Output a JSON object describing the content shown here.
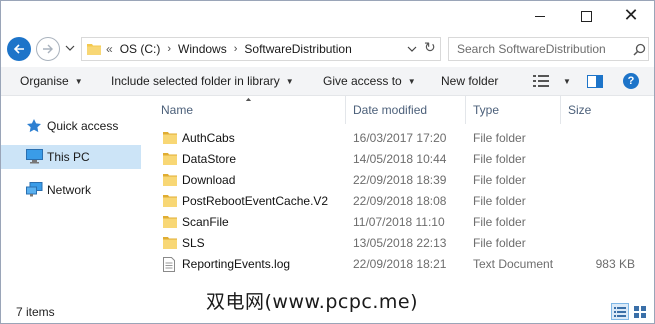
{
  "window": {
    "controls": {
      "minimize": "minimize-icon",
      "maximize": "maximize-icon",
      "close": "close-icon"
    }
  },
  "address_bar": {
    "lead": "«",
    "crumbs": [
      "OS (C:)",
      "Windows",
      "SoftwareDistribution"
    ]
  },
  "search": {
    "placeholder": "Search SoftwareDistribution"
  },
  "commands": {
    "organise": "Organise",
    "include": "Include selected folder in library",
    "give_access": "Give access to",
    "new_folder": "New folder"
  },
  "nav": {
    "quick_access": "Quick access",
    "this_pc": "This PC",
    "network": "Network"
  },
  "columns": {
    "name": "Name",
    "date": "Date modified",
    "type": "Type",
    "size": "Size"
  },
  "files": [
    {
      "name": "AuthCabs",
      "date": "16/03/2017 17:20",
      "type": "File folder",
      "size": "",
      "icon": "folder"
    },
    {
      "name": "DataStore",
      "date": "14/05/2018 10:44",
      "type": "File folder",
      "size": "",
      "icon": "folder"
    },
    {
      "name": "Download",
      "date": "22/09/2018 18:39",
      "type": "File folder",
      "size": "",
      "icon": "folder"
    },
    {
      "name": "PostRebootEventCache.V2",
      "date": "22/09/2018 18:08",
      "type": "File folder",
      "size": "",
      "icon": "folder"
    },
    {
      "name": "ScanFile",
      "date": "11/07/2018 11:10",
      "type": "File folder",
      "size": "",
      "icon": "folder"
    },
    {
      "name": "SLS",
      "date": "13/05/2018 22:13",
      "type": "File folder",
      "size": "",
      "icon": "folder"
    },
    {
      "name": "ReportingEvents.log",
      "date": "22/09/2018 18:21",
      "type": "Text Document",
      "size": "983 KB",
      "icon": "document"
    }
  ],
  "status": {
    "count": "7 items"
  },
  "watermark": "双电网(www.pcpc.me)",
  "colors": {
    "accent": "#1d74c9",
    "selected_nav": "#cce4f7",
    "folder": "#f4c94e"
  }
}
